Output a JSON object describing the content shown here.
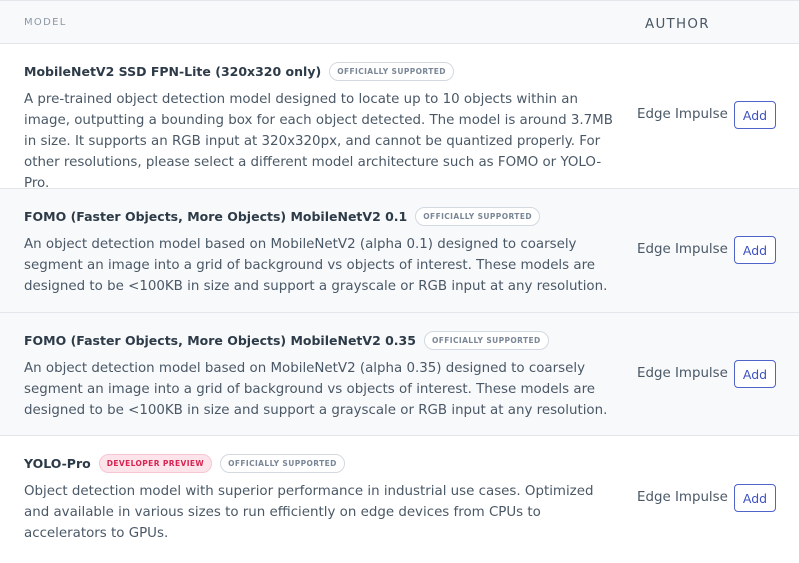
{
  "table": {
    "headers": {
      "model": "MODEL",
      "author": "AUTHOR"
    },
    "rows": [
      {
        "title": "MobileNetV2 SSD FPN-Lite (320x320 only)",
        "badges": [
          "OFFICIALLY SUPPORTED"
        ],
        "description": "A pre-trained object detection model designed to locate up to 10 objects within an image, outputting a bounding box for each object detected. The model is around 3.7MB in size. It supports an RGB input at 320x320px, and cannot be quantized properly. For other resolutions, please select a different model architecture such as FOMO or YOLO-Pro.",
        "author": "Edge Impulse",
        "button": "Add"
      },
      {
        "title": "FOMO (Faster Objects, More Objects) MobileNetV2 0.1",
        "badges": [
          "OFFICIALLY SUPPORTED"
        ],
        "description": "An object detection model based on MobileNetV2 (alpha 0.1) designed to coarsely segment an image into a grid of background vs objects of interest. These models are designed to be <100KB in size and support a grayscale or RGB input at any resolution.",
        "author": "Edge Impulse",
        "button": "Add"
      },
      {
        "title": "FOMO (Faster Objects, More Objects) MobileNetV2 0.35",
        "badges": [
          "OFFICIALLY SUPPORTED"
        ],
        "description": "An object detection model based on MobileNetV2 (alpha 0.35) designed to coarsely segment an image into a grid of background vs objects of interest. These models are designed to be <100KB in size and support a grayscale or RGB input at any resolution.",
        "author": "Edge Impulse",
        "button": "Add"
      },
      {
        "title": "YOLO-Pro",
        "badges": [
          "DEVELOPER PREVIEW",
          "OFFICIALLY SUPPORTED"
        ],
        "description": "Object detection model with superior performance in industrial use cases. Optimized and available in various sizes to run efficiently on edge devices from CPUs to accelerators to GPUs.",
        "author": "Edge Impulse",
        "button": "Add"
      }
    ]
  },
  "colors": {
    "accent": "#3d51c0",
    "preview_badge": "#d62552",
    "header_bg": "#f8f9fb"
  }
}
